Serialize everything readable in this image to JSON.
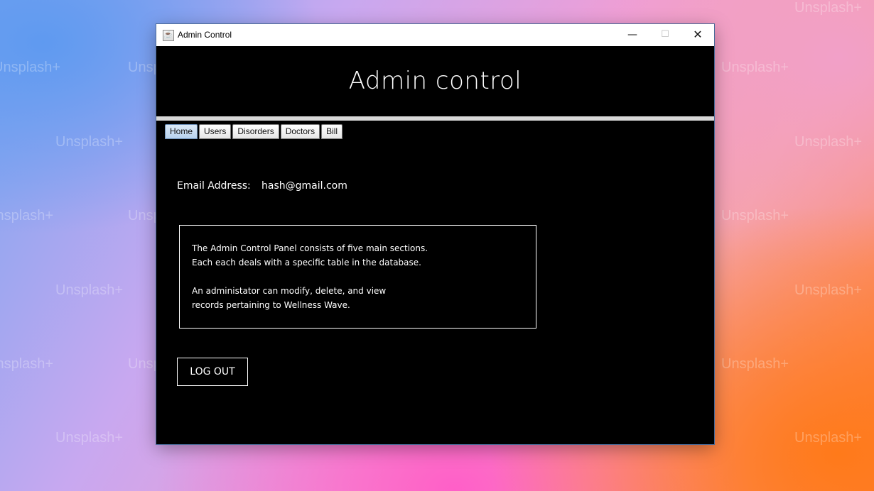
{
  "desktop": {
    "watermarks": [
      "Unsplash+",
      "Unsplash+",
      "Unsplash+",
      "Unsplash+",
      "Unsplash+",
      "Unsplash+",
      "Unsplash+",
      "Unsplash+",
      "Unsplash+",
      "Unsplash+",
      "Unsplash+",
      "Unsplash+",
      "Unsplash+",
      "Unsplash+",
      "Unsplash+",
      "Unsplash+"
    ]
  },
  "window": {
    "title": "Admin Control",
    "minimize_glyph": "—",
    "maximize_glyph": "☐",
    "close_glyph": "✕",
    "app_icon": "java-cup-icon"
  },
  "header": {
    "title": "Admin control"
  },
  "tabs": [
    {
      "label": "Home",
      "active": true
    },
    {
      "label": "Users",
      "active": false
    },
    {
      "label": "Disorders",
      "active": false
    },
    {
      "label": "Doctors",
      "active": false
    },
    {
      "label": "Bill",
      "active": false
    }
  ],
  "account": {
    "email_label": "Email Address:",
    "email_value": "hash@gmail.com"
  },
  "info": {
    "lines": [
      "The Admin Control Panel consists of five main sections.",
      "Each each deals with a specific table in the database.",
      "An administator can modify, delete, and view",
      "records pertaining to Wellness Wave."
    ]
  },
  "actions": {
    "logout_label": "LOG OUT"
  }
}
